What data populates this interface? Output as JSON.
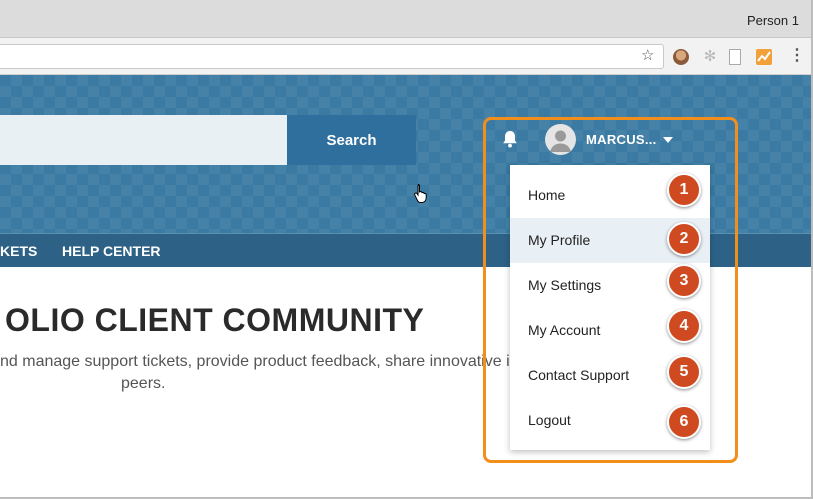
{
  "browser": {
    "profile_name": "Person 1"
  },
  "header": {
    "search_placeholder": "",
    "search_button_label": "Search",
    "user_name": "MARCUS..."
  },
  "nav": {
    "items": [
      {
        "label": "KETS"
      },
      {
        "label": "HELP CENTER"
      }
    ]
  },
  "main": {
    "title": "OLIO CLIENT COMMUNITY",
    "description_line1": "nd manage support tickets, provide product feedback, share innovative ideas",
    "description_line2": "peers."
  },
  "dropdown": {
    "items": [
      {
        "label": "Home",
        "badge": "1"
      },
      {
        "label": "My Profile",
        "badge": "2"
      },
      {
        "label": "My Settings",
        "badge": "3"
      },
      {
        "label": "My Account",
        "badge": "4"
      },
      {
        "label": "Contact Support",
        "badge": "5"
      },
      {
        "label": "Logout",
        "badge": "6"
      }
    ]
  },
  "colors": {
    "header_blue": "#3a7aa3",
    "nav_blue": "#2d6286",
    "highlight_orange": "#f28e1c",
    "badge_red": "#cf4a20"
  },
  "icons": [
    "star-icon",
    "extension-avatar-icon",
    "snowflake-icon",
    "document-icon",
    "chart-extension-icon",
    "more-vert-icon",
    "bell-icon",
    "user-avatar-icon",
    "caret-down-icon",
    "hand-cursor-icon"
  ]
}
